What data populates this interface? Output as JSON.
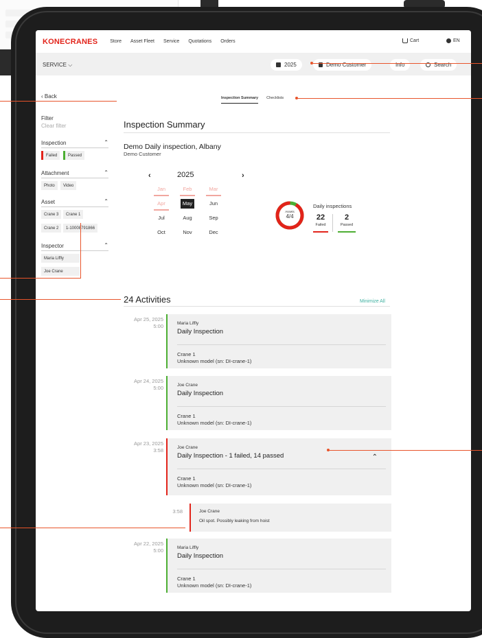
{
  "brand": {
    "logo": "KONECRANES",
    "accent": "#e2231a",
    "passed": "#4cae32",
    "link": "#3db0a0"
  },
  "topnav": {
    "links": [
      "Store",
      "Asset Fleet",
      "Service",
      "Quotations",
      "Orders"
    ],
    "cart": "Cart",
    "language": "EN"
  },
  "servicebar": {
    "section": "SERVICE",
    "year": "2025",
    "customer": "Demo Customer",
    "info": "Info",
    "search": "Search"
  },
  "sidebar": {
    "back": "Back",
    "filter": "Filter",
    "clear_filter": "Clear filter",
    "inspection": {
      "title": "Inspection",
      "chips": [
        "Failed",
        "Passed"
      ]
    },
    "attachment": {
      "title": "Attachment",
      "chips": [
        "Photo",
        "Video"
      ]
    },
    "asset": {
      "title": "Asset",
      "chips": [
        "Crane 3",
        "Crane 1",
        "Crane 2",
        "1-10008791866"
      ]
    },
    "inspector": {
      "title": "Inspector",
      "chips": [
        "Maria Liffly",
        "Joe Crane"
      ]
    }
  },
  "tabs": [
    "Inspection Summary",
    "Checklists"
  ],
  "summary": {
    "heading": "Inspection Summary",
    "inspection_title": "Demo Daily inspection, Albany",
    "inspection_customer": "Demo Customer",
    "year": "2025",
    "months": [
      "Jan",
      "Feb",
      "Mar",
      "Apr",
      "May",
      "Jun",
      "Jul",
      "Aug",
      "Sep",
      "Oct",
      "Nov",
      "Dec"
    ],
    "failed_months": [
      "Jan",
      "Feb",
      "Mar",
      "Apr"
    ],
    "selected_month": "May",
    "assets_label": "Assets",
    "assets_value": "4/4",
    "donut_failed_fraction": 0.92,
    "daily_title": "Daily inspections",
    "failed_count": "22",
    "failed_label": "Failed",
    "passed_count": "2",
    "passed_label": "Passed"
  },
  "activities": {
    "heading": "24 Activities",
    "minimize": "Minimize All",
    "items": [
      {
        "date": "Apr 25, 2025",
        "time": "5:00",
        "user": "Maria Liffly",
        "title": "Daily Inspection",
        "crane": "Crane 1",
        "model": "Unknown model (sn: DI-crane-1)",
        "status": "passed"
      },
      {
        "date": "Apr 24, 2025",
        "time": "5:00",
        "user": "Joe Crane",
        "title": "Daily Inspection",
        "crane": "Crane 1",
        "model": "Unknown model (sn: DI-crane-1)",
        "status": "passed"
      },
      {
        "date": "Apr 23, 2025",
        "time": "3:58",
        "user": "Joe Crane",
        "title": "Daily Inspection - 1 failed, 14 passed",
        "crane": "Crane 1",
        "model": "Unknown model (sn: DI-crane-1)",
        "status": "failed"
      },
      {
        "date": "Apr 22, 2025",
        "time": "5:00",
        "user": "Maria Liffly",
        "title": "Daily Inspection",
        "crane": "Crane 1",
        "model": "Unknown model (sn: DI-crane-1)",
        "status": "passed"
      }
    ],
    "note": {
      "time": "3:58",
      "user": "Joe Crane",
      "text": "Oil spot. Possibly leaking from hoist"
    }
  }
}
